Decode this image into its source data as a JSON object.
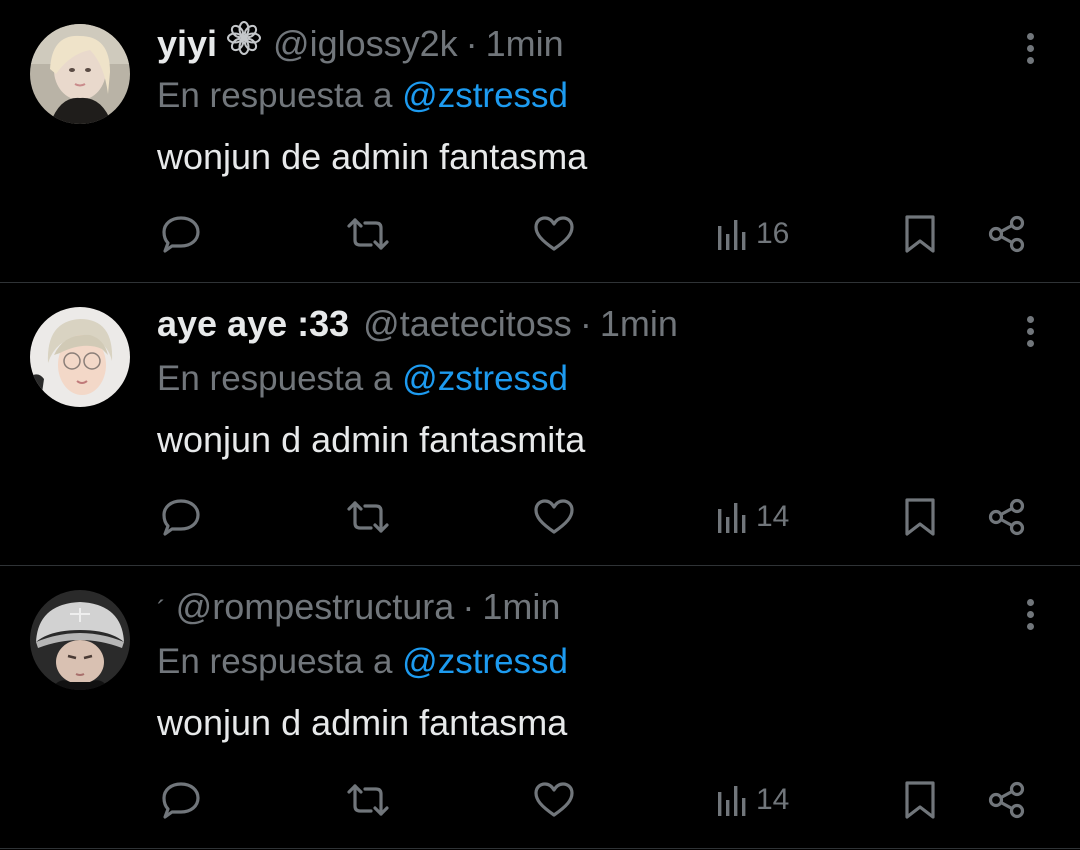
{
  "reply_prefix": "En respuesta a",
  "tweets": [
    {
      "display_name": "yiyi",
      "badge_icon": "flower-emoji-icon",
      "handle": "@iglossy2k",
      "separator": "·",
      "time": "1min",
      "reply_to": "@zstressd",
      "text": "wonjun de admin fantasma",
      "views": "16"
    },
    {
      "display_name": "aye aye :33",
      "handle": "@taetecitoss",
      "separator": "·",
      "time": "1min",
      "reply_to": "@zstressd",
      "text": "wonjun d admin fantasmita",
      "views": "14"
    },
    {
      "display_name": "",
      "handle": "@rompestructura",
      "separator": "·",
      "time": "1min",
      "reply_to": "@zstressd",
      "text": "wonjun d admin fantasma",
      "views": "14"
    }
  ],
  "icons": {
    "reply": "speech-bubble-icon",
    "retweet": "retweet-icon",
    "like": "heart-icon",
    "views": "bar-chart-icon",
    "bookmark": "bookmark-icon",
    "share": "share-icon",
    "more": "vertical-dots-icon"
  },
  "colors": {
    "background": "#000000",
    "primary_text": "#e7e9ea",
    "secondary_text": "#71767b",
    "mention": "#1d9bf0",
    "divider": "#2f3336"
  }
}
